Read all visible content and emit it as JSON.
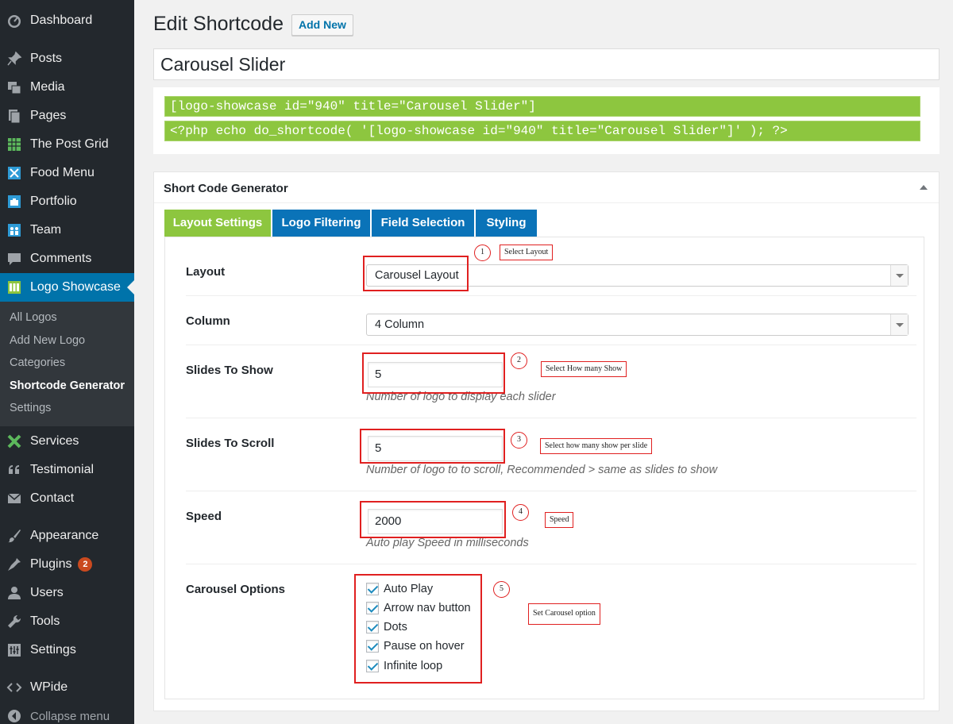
{
  "sidebar": {
    "items": [
      {
        "label": "Dashboard",
        "icon": "dashboard-icon"
      },
      {
        "label": "Posts",
        "icon": "pin-icon"
      },
      {
        "label": "Media",
        "icon": "media-icon"
      },
      {
        "label": "Pages",
        "icon": "pages-icon"
      },
      {
        "label": "The Post Grid",
        "icon": "grid-icon"
      },
      {
        "label": "Food Menu",
        "icon": "food-menu-icon"
      },
      {
        "label": "Portfolio",
        "icon": "portfolio-icon"
      },
      {
        "label": "Team",
        "icon": "team-icon"
      },
      {
        "label": "Comments",
        "icon": "comment-icon"
      },
      {
        "label": "Logo Showcase",
        "icon": "logo-showcase-icon"
      },
      {
        "label": "Services",
        "icon": "services-icon"
      },
      {
        "label": "Testimonial",
        "icon": "quote-icon"
      },
      {
        "label": "Contact",
        "icon": "mail-icon"
      },
      {
        "label": "Appearance",
        "icon": "brush-icon"
      },
      {
        "label": "Plugins",
        "icon": "plugin-icon",
        "badge": "2"
      },
      {
        "label": "Users",
        "icon": "user-icon"
      },
      {
        "label": "Tools",
        "icon": "wrench-icon"
      },
      {
        "label": "Settings",
        "icon": "settings-icon"
      },
      {
        "label": "WPide",
        "icon": "code-icon"
      },
      {
        "label": "Collapse menu",
        "icon": "collapse-icon"
      }
    ],
    "submenu": [
      "All Logos",
      "Add New Logo",
      "Categories",
      "Shortcode Generator",
      "Settings"
    ],
    "active_color": "#0073aa"
  },
  "header": {
    "title": "Edit Shortcode",
    "add_new_label": "Add New"
  },
  "post_title": "Carousel Slider",
  "shortcodes": {
    "shortcode": "[logo-showcase id=\"940\" title=\"Carousel Slider\"]",
    "php": "<?php echo do_shortcode( '[logo-showcase id=\"940\" title=\"Carousel Slider\"]' ); ?>"
  },
  "panel": {
    "title": "Short Code Generator",
    "tabs": [
      "Layout Settings",
      "Logo Filtering",
      "Field Selection",
      "Styling"
    ],
    "fields": {
      "layout": {
        "label": "Layout",
        "value": "Carousel Layout"
      },
      "column": {
        "label": "Column",
        "value": "4 Column"
      },
      "slides_to_show": {
        "label": "Slides To Show",
        "value": "5",
        "description": "Number of logo to display each slider"
      },
      "slides_to_scroll": {
        "label": "Slides To Scroll",
        "value": "5",
        "description": "Number of logo to to scroll, Recommended > same as slides to show"
      },
      "speed": {
        "label": "Speed",
        "value": "2000",
        "description": "Auto play Speed in milliseconds"
      },
      "carousel_options": {
        "label": "Carousel Options",
        "options": [
          "Auto Play",
          "Arrow nav button",
          "Dots",
          "Pause on hover",
          "Infinite loop"
        ],
        "checked": [
          true,
          true,
          true,
          true,
          true
        ]
      }
    }
  },
  "annotations": [
    {
      "number": "1",
      "label": "Select  Layout"
    },
    {
      "number": "2",
      "label": "Select How many Show"
    },
    {
      "number": "3",
      "label": "Select how many show per slide"
    },
    {
      "number": "4",
      "label": "Speed"
    },
    {
      "number": "5",
      "label": "Set Carousel option"
    }
  ],
  "colors": {
    "tab_active": "#8dc63f",
    "tab": "#0a73b8",
    "shortcode_bg": "#8dc63f",
    "annotation": "#e02020"
  }
}
